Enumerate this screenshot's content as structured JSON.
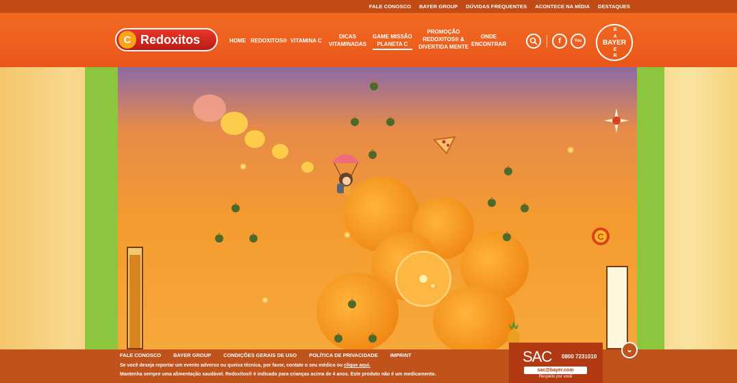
{
  "topbar": {
    "links": [
      "FALE CONOSCO",
      "BAYER GROUP",
      "DÚVIDAS FREQUENTES",
      "ACONTECE NA MÍDIA",
      "DESTAQUES"
    ]
  },
  "header": {
    "logo_text": "Redoxitos",
    "logo_mark": "C",
    "nav": {
      "home": "HOME",
      "redoxitos": "REDOXITOS®",
      "vitamina_c": "VITAMINA C",
      "dicas_1": "DICAS",
      "dicas_2": "VITAMINADAS",
      "game_1": "GAME MISSÃO",
      "game_2": "PLANETA C",
      "promo_1": "PROMOÇÃO",
      "promo_2": "REDOXITOS® &",
      "promo_3": "DIVERTIDA MENTE",
      "onde_1": "ONDE",
      "onde_2": "ENCONTRAR"
    },
    "icons": {
      "search": "🔍",
      "facebook": "f",
      "youtube": "You"
    },
    "bayer_horizontal": "BAYER",
    "bayer_vertical": [
      "B",
      "A",
      "Y",
      "E",
      "R"
    ]
  },
  "game": {
    "accent": "#f49b2f",
    "energy_level": 0.93
  },
  "footer": {
    "links": [
      "FALE CONOSCO",
      "BAYER GROUP",
      "CONDIÇÕES GERAIS DE USO",
      "POLÍTICA DE PRIVACIDADE",
      "IMPRINT"
    ],
    "report_text": "Se você deseja reportar um evento adverso ou queixa técnica, por favor, contate o seu médico ou",
    "report_link": "clique aqui.",
    "disclaimer": "Mantenha sempre uma alimentação saudável. Redoxitos® é indicado para crianças acima de 4 anos. Este produto não é um medicamento."
  },
  "sac": {
    "label": "SAC",
    "phone": "0800 7231010",
    "email": "sac@bayer.com",
    "tagline": "Respeito por você"
  },
  "scroll_down_icon": "⌄"
}
